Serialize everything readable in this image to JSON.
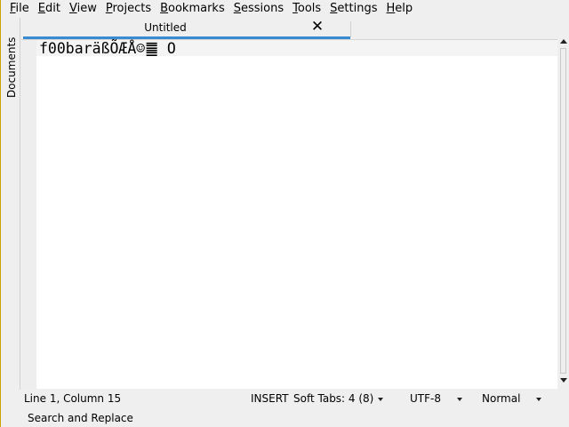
{
  "menu": [
    {
      "label_ul": "F",
      "label_rest": "ile"
    },
    {
      "label_ul": "E",
      "label_rest": "dit"
    },
    {
      "label_ul": "V",
      "label_rest": "iew"
    },
    {
      "label_ul": "P",
      "label_rest": "rojects"
    },
    {
      "label_ul": "B",
      "label_rest": "ookmarks"
    },
    {
      "label_ul": "S",
      "label_rest": "essions"
    },
    {
      "label_ul": "T",
      "label_rest": "ools"
    },
    {
      "label_ul": "S",
      "label_rest": "ettings"
    },
    {
      "label_ul": "H",
      "label_rest": "elp"
    }
  ],
  "side_panel": {
    "documents_label": "Documents"
  },
  "tabs": {
    "active_label": "Untitled"
  },
  "editor": {
    "text": "f00baräßÕÆÅ☺䷀ O"
  },
  "status": {
    "position": "Line 1, Column 15",
    "mode": "INSERT",
    "indent": "Soft Tabs: 4 (8)",
    "encoding": "UTF-8",
    "view_mode": "Normal"
  },
  "bottom": {
    "search_replace_label": "Search and Replace"
  },
  "colors": {
    "tab_active_underline": "#3b8bd3",
    "window_border": "#c8a200"
  }
}
